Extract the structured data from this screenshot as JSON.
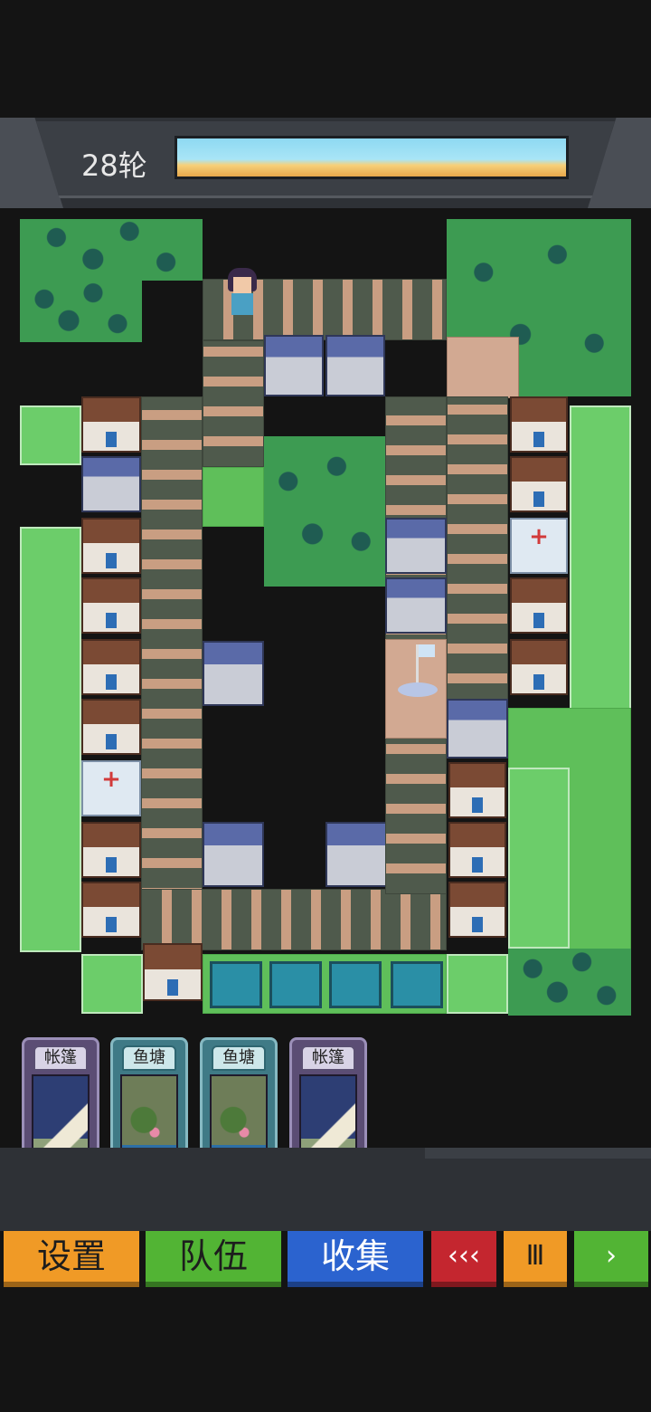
{
  "hud": {
    "round_label": "28轮"
  },
  "cards": [
    {
      "title": "帐篷",
      "kind": "tent"
    },
    {
      "title": "鱼塘",
      "kind": "pond"
    },
    {
      "title": "鱼塘",
      "kind": "pond"
    },
    {
      "title": "帐篷",
      "kind": "tent"
    }
  ],
  "buttons": {
    "settings": "设置",
    "team": "队伍",
    "collect": "收集",
    "rewind": "‹‹‹",
    "pause": "Ⅲ",
    "play": "›"
  },
  "colors": {
    "settings": "#f09a26",
    "team": "#52b434",
    "collect": "#2b63cf",
    "rewind": "#c4262f",
    "pause": "#f09a26",
    "play": "#52b434"
  }
}
